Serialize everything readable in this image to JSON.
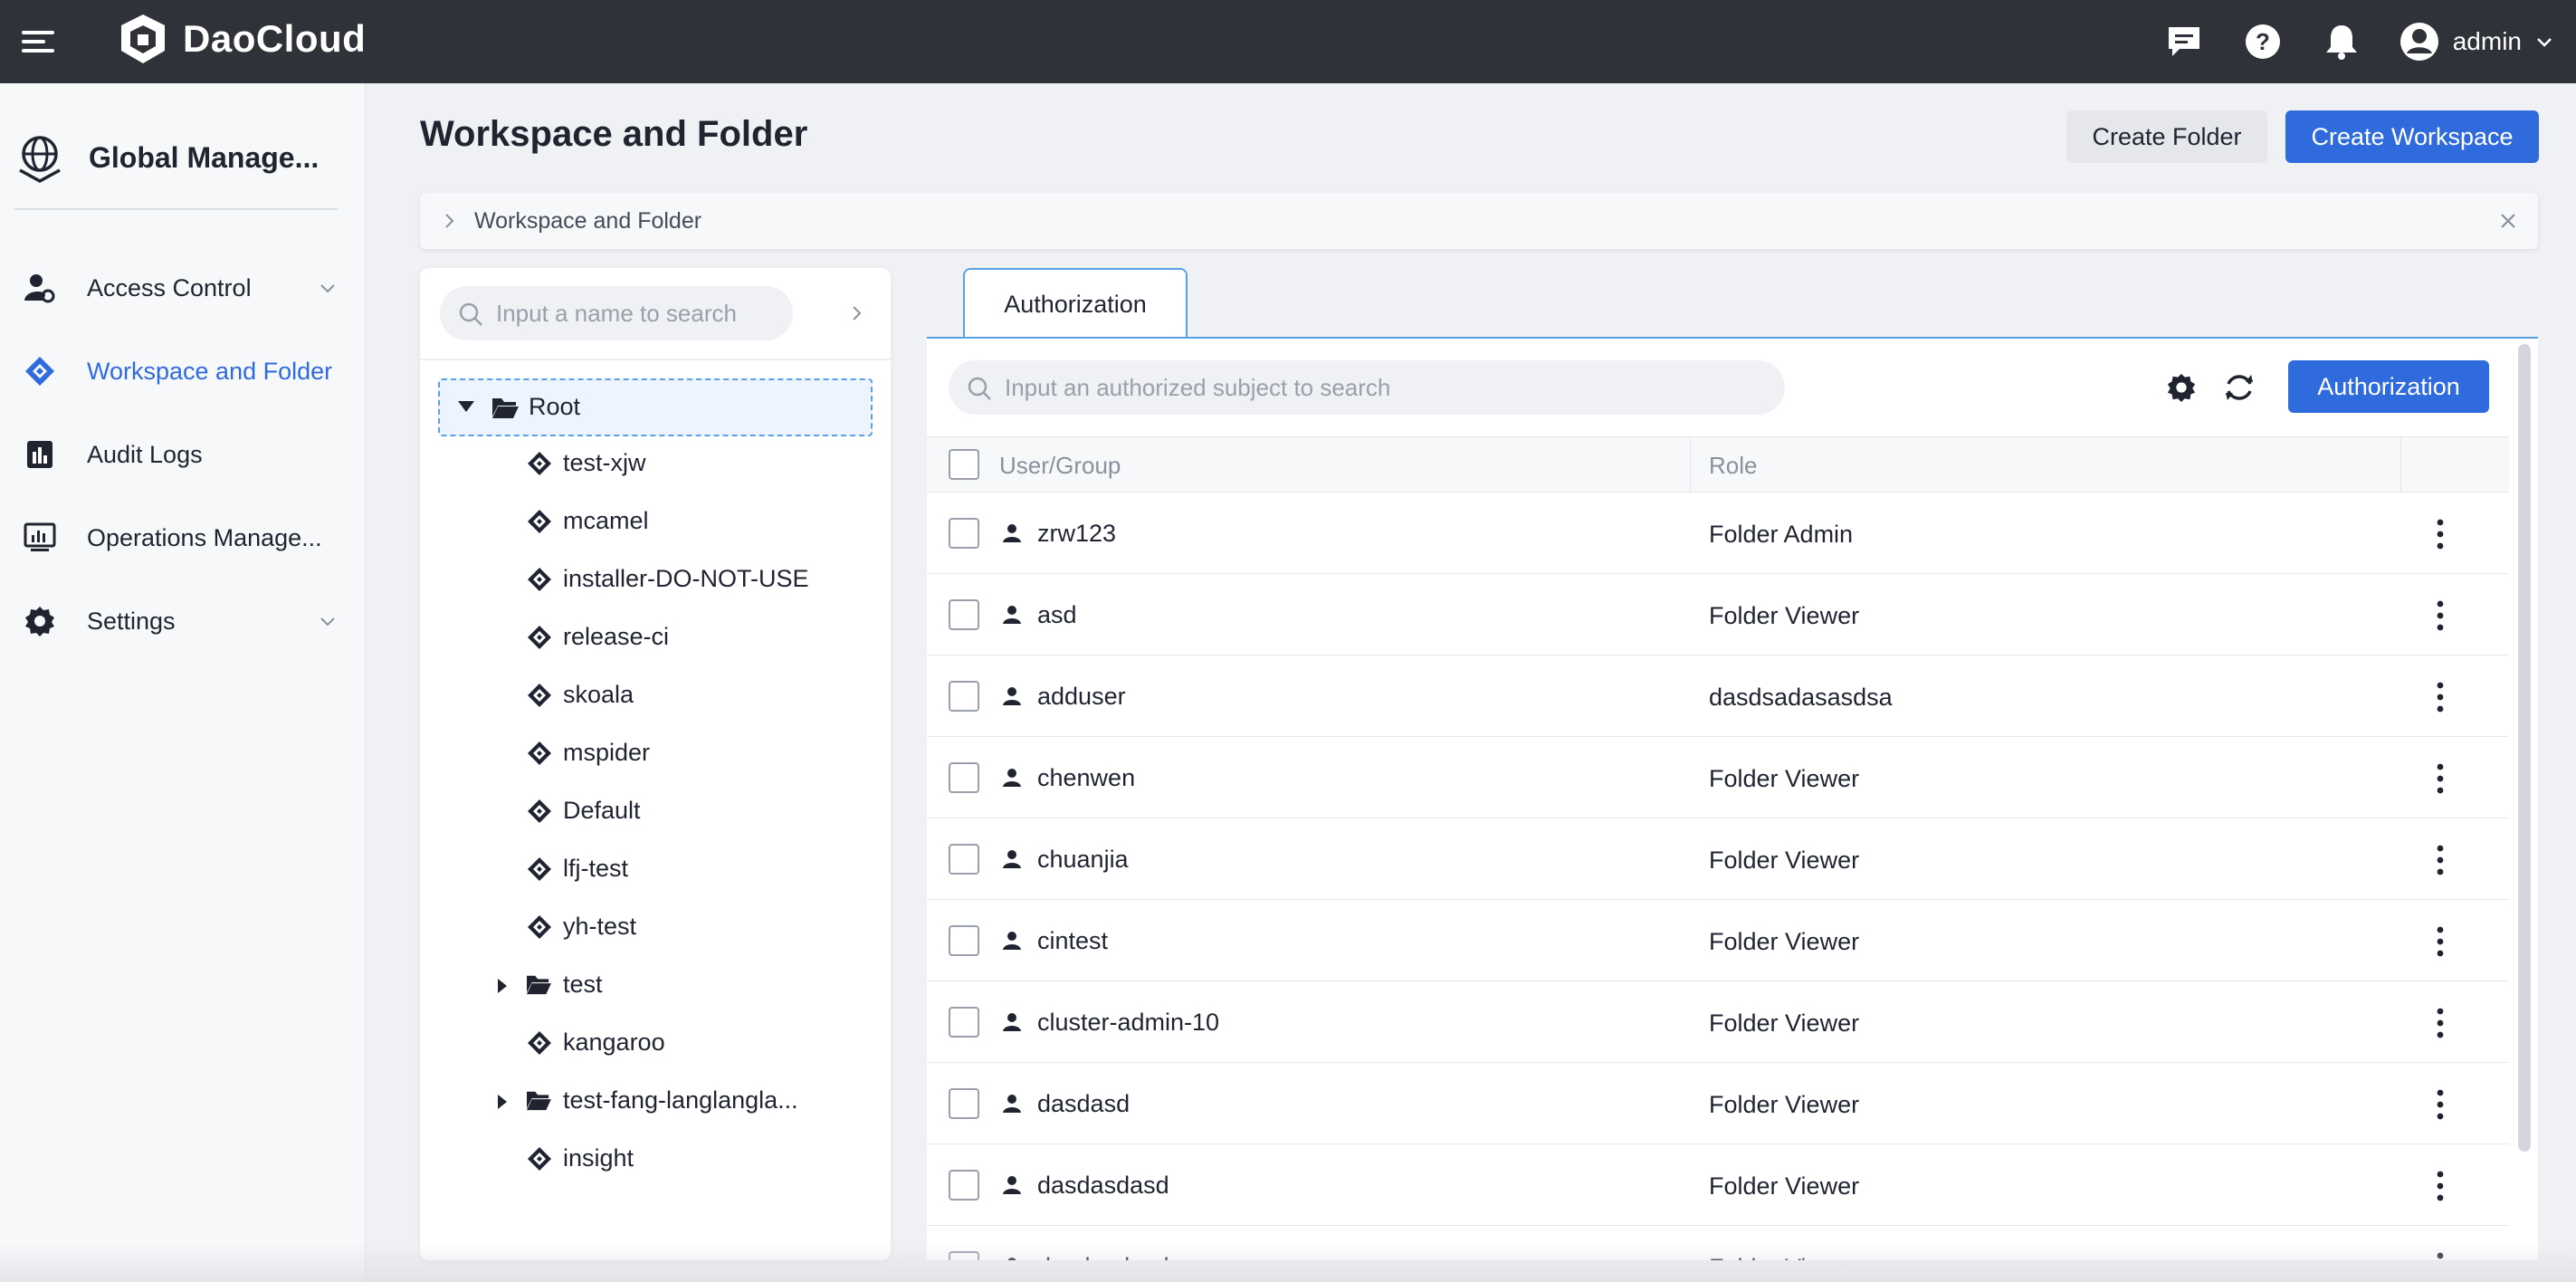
{
  "topbar": {
    "brand": "DaoCloud",
    "user_name": "admin",
    "icons": [
      "menu-icon",
      "chat-icon",
      "help-icon",
      "bell-icon",
      "user-avatar-icon",
      "chevron-down-icon"
    ]
  },
  "sidebar": {
    "title": "Global Manage...",
    "items": [
      {
        "label": "Access Control",
        "icon": "user-gear-icon",
        "expandable": true,
        "active": false
      },
      {
        "label": "Workspace and Folder",
        "icon": "workspace-icon",
        "expandable": false,
        "active": true
      },
      {
        "label": "Audit Logs",
        "icon": "audit-chart-icon",
        "expandable": false,
        "active": false
      },
      {
        "label": "Operations Manage...",
        "icon": "operations-icon",
        "expandable": false,
        "active": false
      },
      {
        "label": "Settings",
        "icon": "gear-icon",
        "expandable": true,
        "active": false
      }
    ]
  },
  "page": {
    "title": "Workspace and Folder",
    "create_folder": "Create Folder",
    "create_workspace": "Create Workspace",
    "breadcrumb": "Workspace and Folder"
  },
  "tree": {
    "search_placeholder": "Input a name to search",
    "root": "Root",
    "nodes": [
      {
        "label": "test-xjw",
        "type": "workspace"
      },
      {
        "label": "mcamel",
        "type": "workspace"
      },
      {
        "label": "installer-DO-NOT-USE",
        "type": "workspace"
      },
      {
        "label": "release-ci",
        "type": "workspace"
      },
      {
        "label": "skoala",
        "type": "workspace"
      },
      {
        "label": "mspider",
        "type": "workspace"
      },
      {
        "label": "Default",
        "type": "workspace"
      },
      {
        "label": "lfj-test",
        "type": "workspace"
      },
      {
        "label": "yh-test",
        "type": "workspace"
      },
      {
        "label": "test",
        "type": "folder"
      },
      {
        "label": "kangaroo",
        "type": "workspace"
      },
      {
        "label": "test-fang-langlangla...",
        "type": "folder"
      },
      {
        "label": "insight",
        "type": "workspace"
      }
    ]
  },
  "auth": {
    "tab": "Authorization",
    "search_placeholder": "Input an authorized subject to search",
    "button": "Authorization",
    "columns": {
      "user": "User/Group",
      "role": "Role"
    },
    "rows": [
      {
        "name": "zrw123",
        "role": "Folder Admin"
      },
      {
        "name": "asd",
        "role": "Folder Viewer"
      },
      {
        "name": "adduser",
        "role": "dasdsadasasdsa"
      },
      {
        "name": "chenwen",
        "role": "Folder Viewer"
      },
      {
        "name": "chuanjia",
        "role": "Folder Viewer"
      },
      {
        "name": "cintest",
        "role": "Folder Viewer"
      },
      {
        "name": "cluster-admin-10",
        "role": "Folder Viewer"
      },
      {
        "name": "dasdasd",
        "role": "Folder Viewer"
      },
      {
        "name": "dasdasdasd",
        "role": "Folder Viewer"
      },
      {
        "name": "dasdasdasd",
        "role": "Folder Viewer"
      }
    ]
  },
  "colors": {
    "topbar": "#30323a",
    "accent": "#2f6bdc",
    "tab_border": "#5aa0e6",
    "sidebar_bg": "#f7f8fa",
    "page_bg": "#f0f1f5"
  }
}
